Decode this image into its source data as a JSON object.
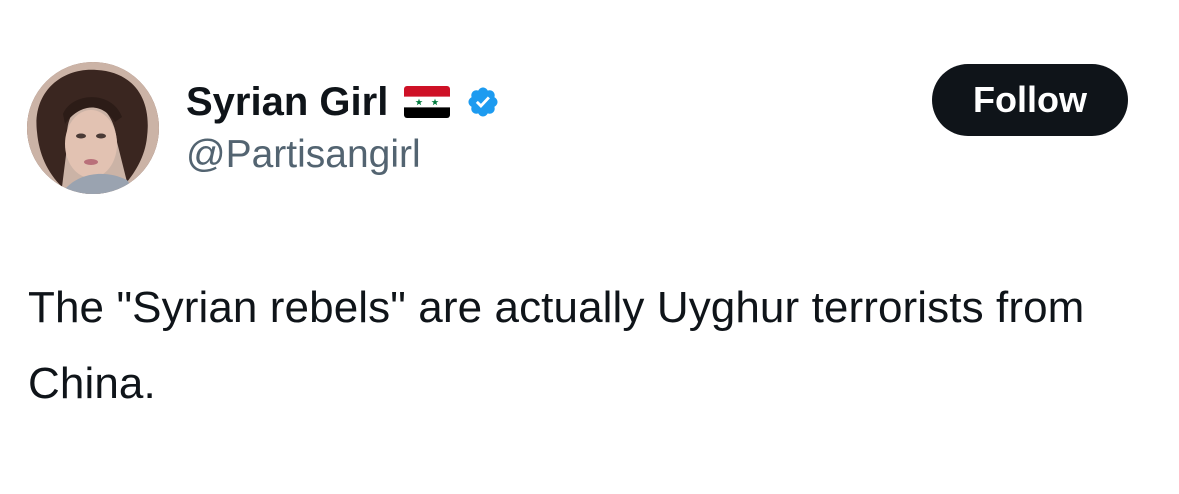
{
  "author": {
    "display_name": "Syrian Girl",
    "handle": "@Partisangirl",
    "flag_icon": "syria-flag-icon",
    "verified_icon": "verified-badge-icon",
    "verified_color": "#1d9bf0"
  },
  "actions": {
    "follow_label": "Follow"
  },
  "tweet": {
    "text": "The \"Syrian rebels\" are actually Uyghur terrorists from China."
  },
  "colors": {
    "text_primary": "#0f1419",
    "text_secondary": "#536471",
    "follow_bg": "#0f1419",
    "follow_text": "#ffffff",
    "flag_red": "#ce1126",
    "flag_white": "#ffffff",
    "flag_black": "#000000",
    "flag_star_green": "#007a3d"
  }
}
